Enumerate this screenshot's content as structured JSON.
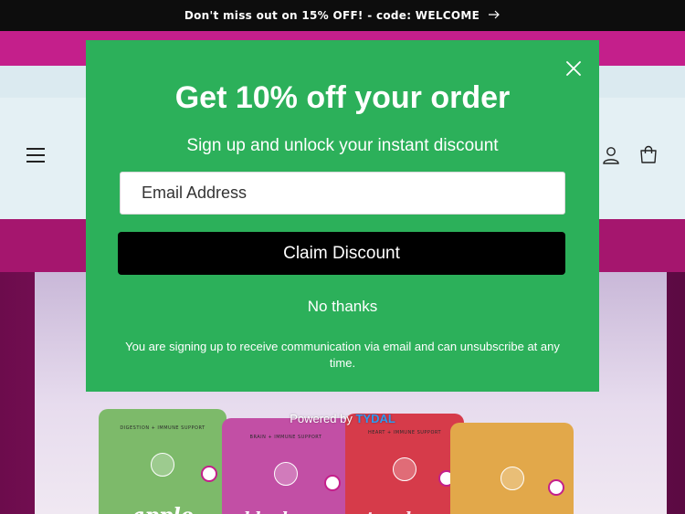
{
  "announcement": {
    "text": "Don't miss out on 15% OFF! - code: WELCOME",
    "arrow_icon": "arrow-right-icon"
  },
  "header": {
    "menu_icon": "hamburger-menu-icon",
    "account_icon": "account-icon",
    "cart_icon": "cart-icon"
  },
  "hero": {
    "products": [
      {
        "name": "apple",
        "tag": "DIGESTION + IMMUNE SUPPORT",
        "color": "#7dba6a"
      },
      {
        "name": "blueberry",
        "tag": "BRAIN + IMMUNE SUPPORT",
        "color": "#c24fa5"
      },
      {
        "name": "strawberry",
        "tag": "HEART + IMMUNE SUPPORT",
        "color": "#d63b4a"
      },
      {
        "name": "",
        "tag": "",
        "color": "#e2a84a"
      }
    ]
  },
  "modal": {
    "title": "Get 10% off your order",
    "subtitle": "Sign up and unlock your instant discount",
    "email_placeholder": "Email Address",
    "claim_button": "Claim Discount",
    "no_thanks": "No thanks",
    "disclaimer": "You are signing up to receive communication via email and can unsubscribe at any time.",
    "close_icon": "close-icon",
    "background_color": "#2cb05a"
  },
  "powered_by": {
    "prefix": "Powered by",
    "brand": "TYDAL"
  }
}
